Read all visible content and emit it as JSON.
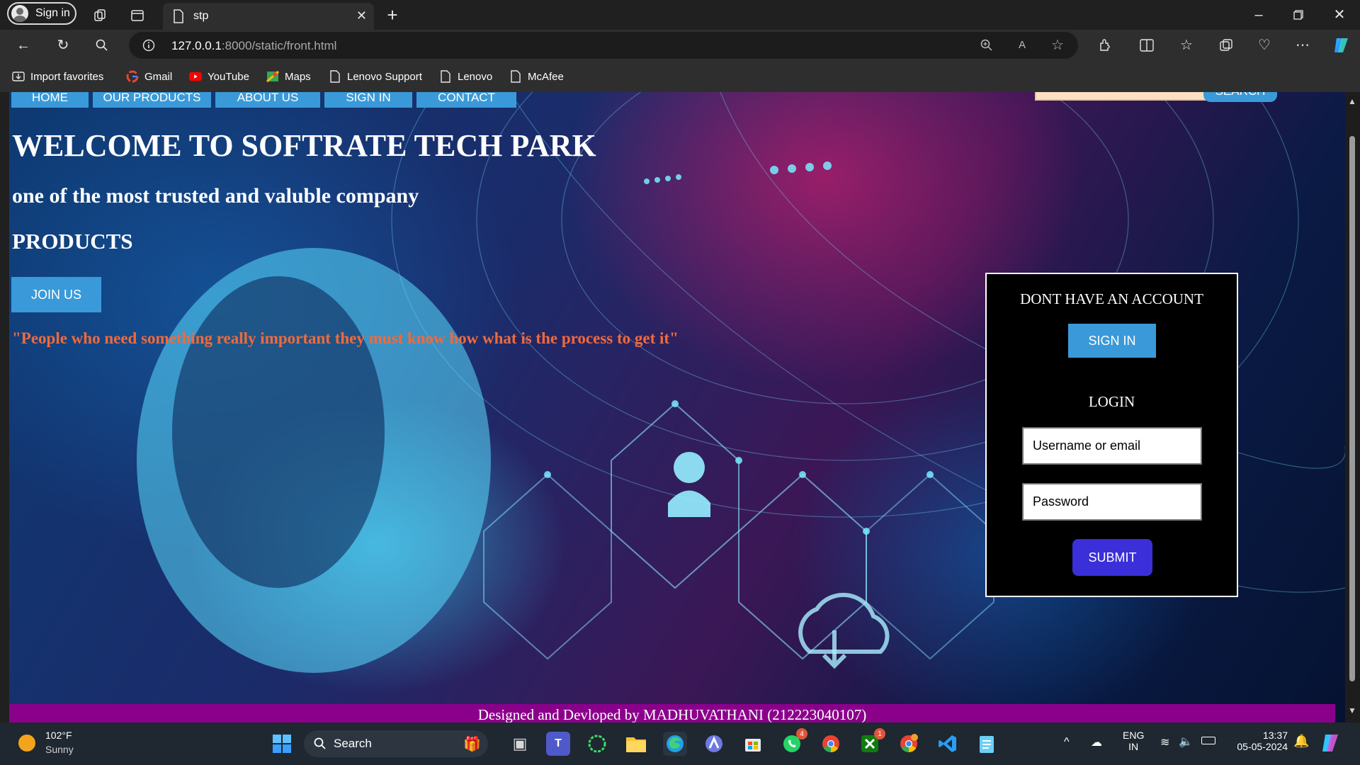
{
  "browser": {
    "profile_label": "Sign in",
    "tab_title": "stp",
    "url_host": "127.0.0.1",
    "url_path": ":8000/static/front.html",
    "favorites": [
      "Import favorites",
      "Gmail",
      "YouTube",
      "Maps",
      "Lenovo Support",
      "Lenovo",
      "McAfee"
    ]
  },
  "nav": {
    "items": [
      "HOME",
      "OUR PRODUCTS",
      "ABOUT US",
      "SIGN IN",
      "CONTACT"
    ],
    "search_label": "SEARCH"
  },
  "hero": {
    "title": "WELCOME TO SOFTRATE TECH PARK",
    "tagline": "one of the most trusted and valuble company",
    "products": "PRODUCTS",
    "join_label": "JOIN US",
    "quote": "\"People who need something really important they must know how what is the process to get it\""
  },
  "login_card": {
    "no_account": "DONT HAVE AN ACCOUNT",
    "signin_label": "SIGN IN",
    "login_heading": "LOGIN",
    "username_placeholder": "Username or email",
    "password_placeholder": "Password",
    "submit_label": "SUBMIT"
  },
  "footer": {
    "text": "Designed and Devloped by MADHUVATHANI (212223040107)"
  },
  "taskbar": {
    "weather_temp": "102°F",
    "weather_desc": "Sunny",
    "search_label": "Search",
    "lang_line1": "ENG",
    "lang_line2": "IN",
    "time": "13:37",
    "date": "05-05-2024",
    "whatsapp_badge": "4",
    "xbox_badge": "1"
  },
  "colors": {
    "nav_blue": "#3a9ad9",
    "submit_purple": "#3a2fd9",
    "footer_magenta": "#8b008b",
    "quote_orange": "#f06a3c"
  }
}
